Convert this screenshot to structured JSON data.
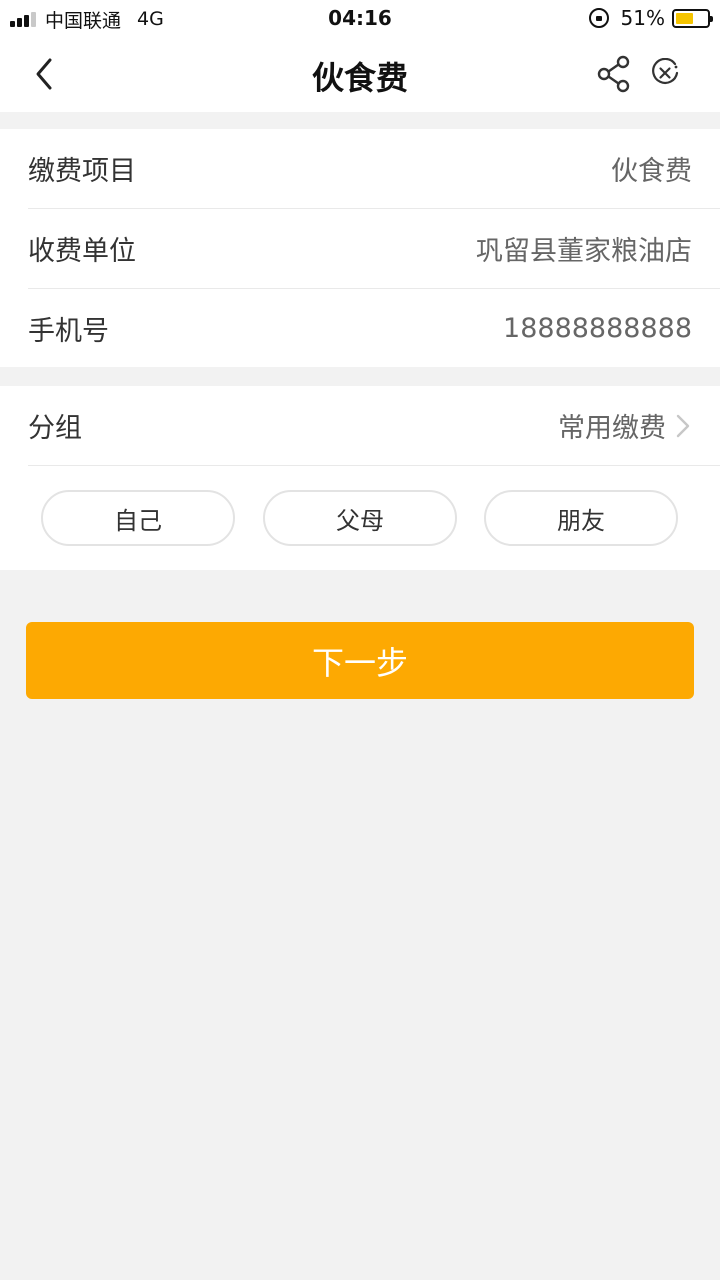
{
  "status_bar": {
    "carrier": "中国联通",
    "network": "4G",
    "time": "04:16",
    "battery_percent": "51%",
    "battery_level": 0.51,
    "battery_color": "#f5c400"
  },
  "nav": {
    "title": "伙食费",
    "back_icon": "chevron-left-icon",
    "share_icon": "share-icon",
    "close_icon": "close-circle-icon"
  },
  "info": {
    "rows": [
      {
        "label": "缴费项目",
        "value": "伙食费"
      },
      {
        "label": "收费单位",
        "value": "巩留县董家粮油店"
      },
      {
        "label": "手机号",
        "value": "18888888888"
      }
    ]
  },
  "group": {
    "label": "分组",
    "value": "常用缴费",
    "chips": [
      "自己",
      "父母",
      "朋友"
    ]
  },
  "actions": {
    "next_label": "下一步",
    "next_color": "#fda902"
  }
}
